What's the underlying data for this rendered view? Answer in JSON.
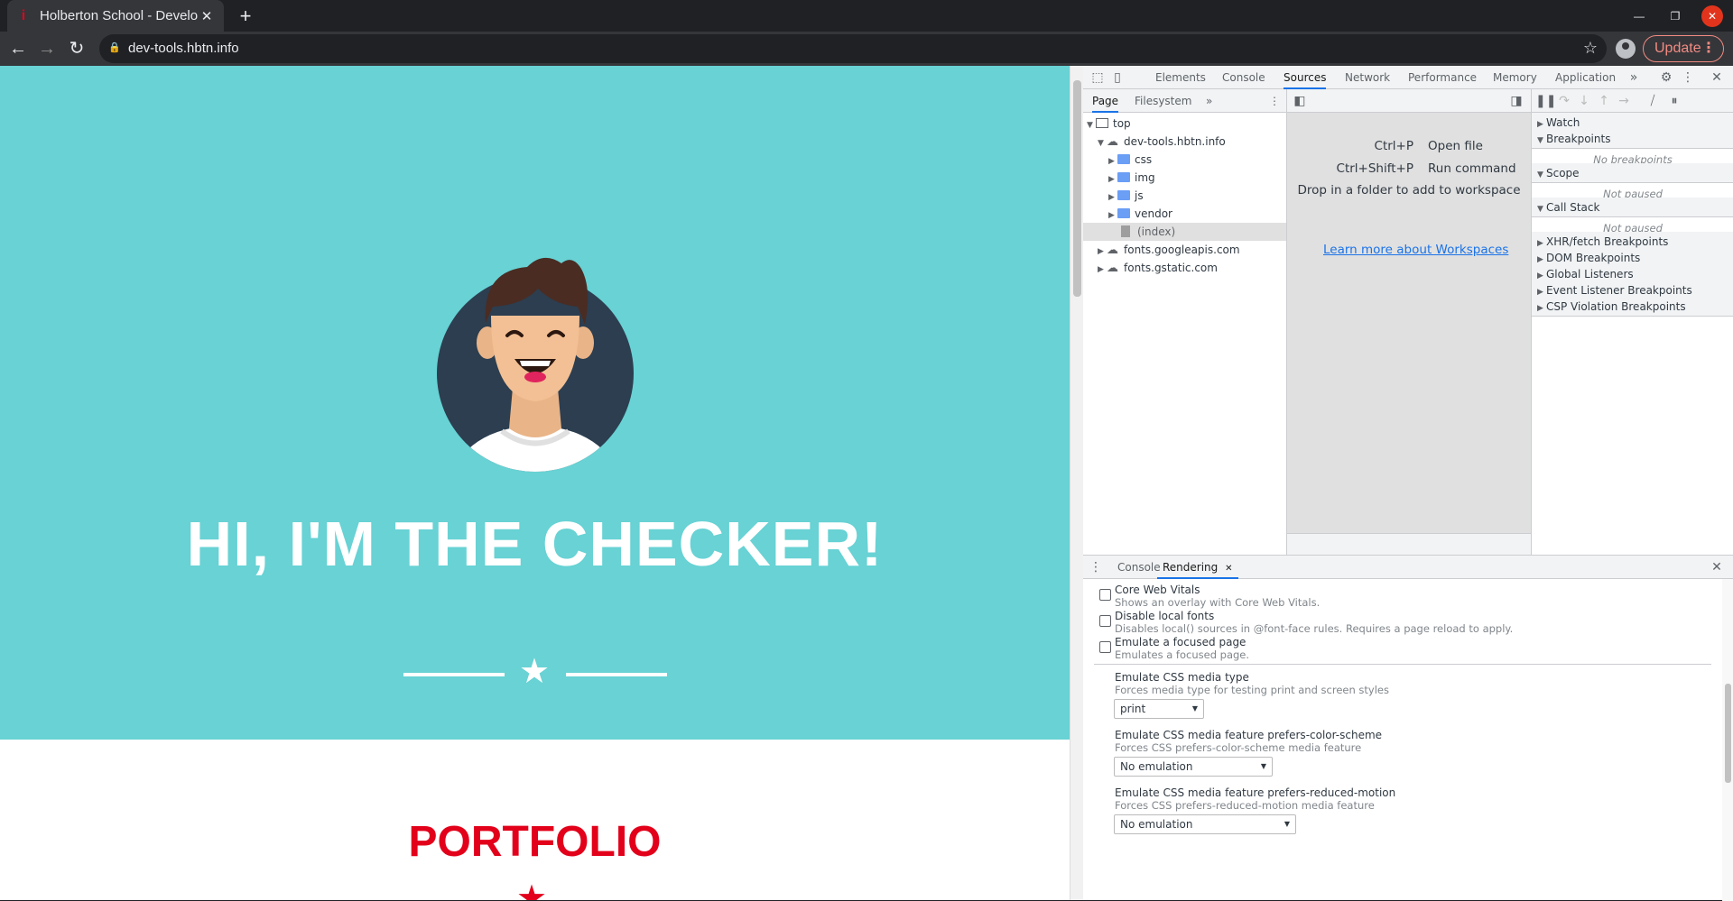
{
  "browser": {
    "tab_title": "Holberton School - Develo",
    "tab_close": "✕",
    "new_tab": "+",
    "url": "dev-tools.hbtn.info",
    "update_label": "Update",
    "update_menu": "⋮",
    "bookmark_icon": "☆"
  },
  "page": {
    "hero_title": "HI, I'M THE CHECKER!",
    "portfolio_title": "PORTFOLIO",
    "colors": {
      "hero_bg": "#68d2d4",
      "accent": "#e2001a"
    }
  },
  "devtools": {
    "panels": [
      "Elements",
      "Console",
      "Sources",
      "Network",
      "Performance",
      "Memory",
      "Application"
    ],
    "active_panel": "Sources",
    "more_panels": "»",
    "navigator": {
      "tabs": [
        "Page",
        "Filesystem"
      ],
      "more": "»",
      "tree": {
        "top": "top",
        "domain": "dev-tools.hbtn.info",
        "folders": [
          "css",
          "img",
          "js",
          "vendor"
        ],
        "index": "(index)",
        "other_domains": [
          "fonts.googleapis.com",
          "fonts.gstatic.com"
        ]
      }
    },
    "editor": {
      "shortcuts": [
        {
          "keys": "Ctrl+P",
          "action": "Open file"
        },
        {
          "keys": "Ctrl+Shift+P",
          "action": "Run command"
        }
      ],
      "drop_text": "Drop in a folder to add to workspace",
      "learn_link": "Learn more about Workspaces"
    },
    "debugger": {
      "sections": [
        {
          "label": "Watch",
          "expanded": false
        },
        {
          "label": "Breakpoints",
          "expanded": true,
          "body": "No breakpoints"
        },
        {
          "label": "Scope",
          "expanded": true,
          "body": "Not paused"
        },
        {
          "label": "Call Stack",
          "expanded": true,
          "body": "Not paused"
        },
        {
          "label": "XHR/fetch Breakpoints",
          "expanded": false
        },
        {
          "label": "DOM Breakpoints",
          "expanded": false
        },
        {
          "label": "Global Listeners",
          "expanded": false
        },
        {
          "label": "Event Listener Breakpoints",
          "expanded": false
        },
        {
          "label": "CSP Violation Breakpoints",
          "expanded": false
        }
      ]
    },
    "drawer": {
      "tabs": [
        "Console",
        "Rendering"
      ],
      "active_tab": "Rendering",
      "rendering": {
        "checkboxes": [
          {
            "title": "Core Web Vitals",
            "desc": "Shows an overlay with Core Web Vitals.",
            "checked": false
          },
          {
            "title": "Disable local fonts",
            "desc": "Disables local() sources in @font-face rules. Requires a page reload to apply.",
            "checked": false
          },
          {
            "title": "Emulate a focused page",
            "desc": "Emulates a focused page.",
            "checked": false
          }
        ],
        "selects": [
          {
            "title": "Emulate CSS media type",
            "desc": "Forces media type for testing print and screen styles",
            "value": "print"
          },
          {
            "title": "Emulate CSS media feature prefers-color-scheme",
            "desc": "Forces CSS prefers-color-scheme media feature",
            "value": "No emulation"
          },
          {
            "title": "Emulate CSS media feature prefers-reduced-motion",
            "desc": "Forces CSS prefers-reduced-motion media feature",
            "value": "No emulation"
          }
        ]
      }
    }
  }
}
